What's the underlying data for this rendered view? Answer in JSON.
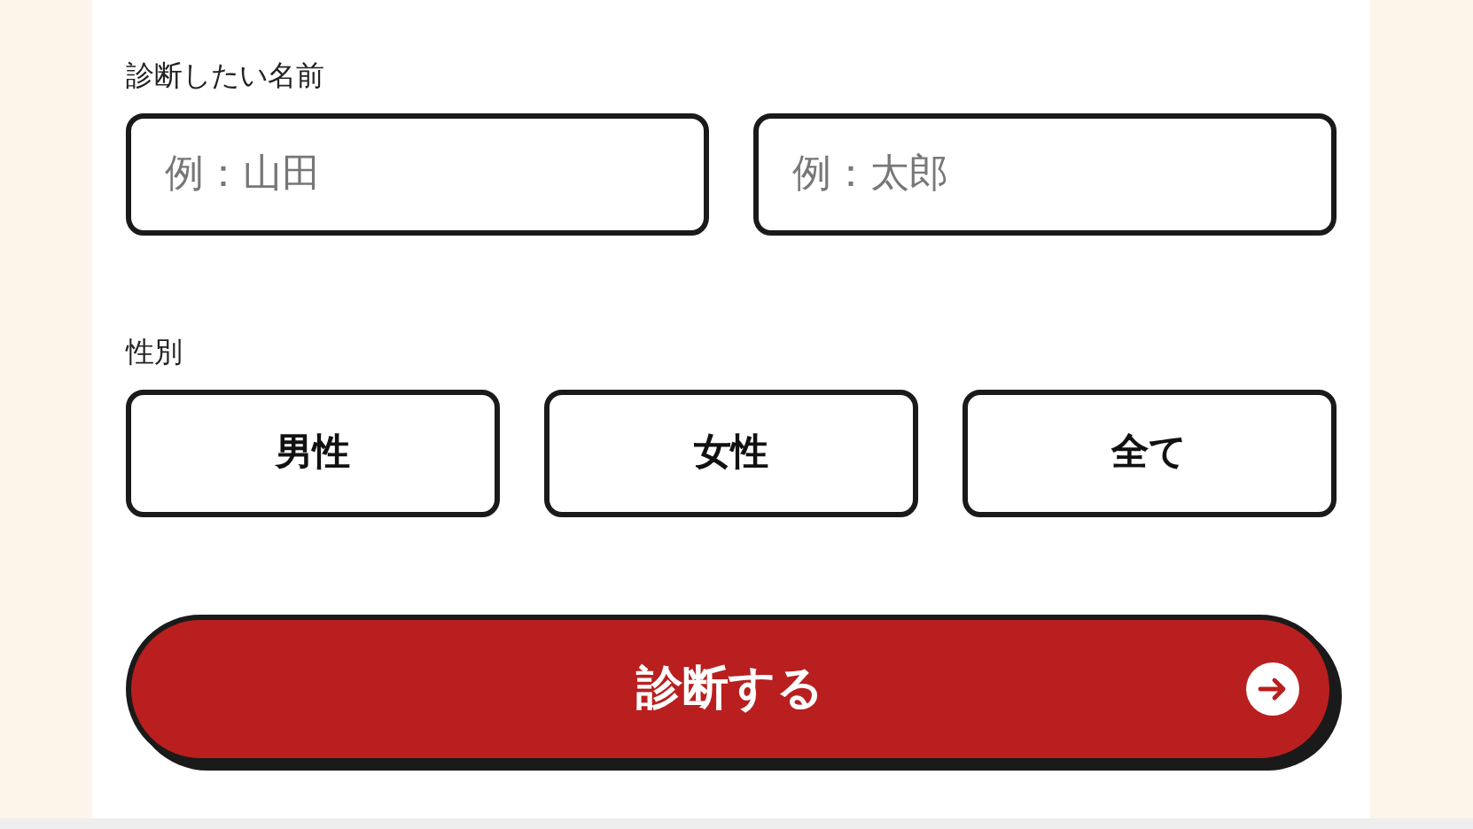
{
  "name_label": "診断したい名前",
  "name_fields": [
    {
      "placeholder": "例：山田"
    },
    {
      "placeholder": "例：太郎"
    }
  ],
  "gender_label": "性別",
  "gender_options": [
    {
      "label": "男性",
      "selected": false
    },
    {
      "label": "女性",
      "selected": false
    },
    {
      "label": "全て",
      "selected": false
    }
  ],
  "submit_button": {
    "label": "診断する"
  }
}
